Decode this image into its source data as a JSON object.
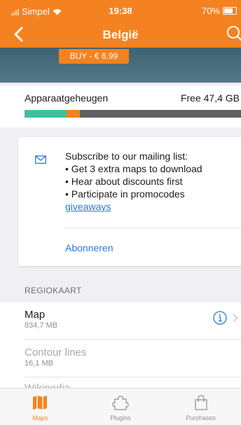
{
  "status_bar": {
    "carrier": "Simpel",
    "time": "19:38",
    "battery": "70%"
  },
  "nav": {
    "title": "België"
  },
  "hero": {
    "buy_label": "BUY - € 6,99"
  },
  "storage": {
    "label": "Apparaatgeheugen",
    "free": "Free 47,4 GB",
    "segments": [
      {
        "name": "other",
        "fraction": 0.195,
        "color": "#3ec1a0"
      },
      {
        "name": "maps",
        "fraction": 0.06,
        "color": "#f58220"
      },
      {
        "name": "rest",
        "fraction": 0.745,
        "color": "#606060"
      }
    ]
  },
  "mailing": {
    "line1": "Subscribe to our mailing list:",
    "line2": "• Get 3 extra maps to download",
    "line3": "• Hear about discounts first",
    "line4": "• Participate in promocodes",
    "link": "giveaways",
    "action": "Abonneren"
  },
  "section": {
    "header": "REGIOKAART"
  },
  "rows": [
    {
      "title": "Map",
      "size": "834,7 MB"
    },
    {
      "title": "Contour lines",
      "size": "16,1 MB"
    },
    {
      "title": "Wikipedia"
    }
  ],
  "tabs": [
    {
      "label": "Maps",
      "icon": "map-icon"
    },
    {
      "label": "Plugins",
      "icon": "puzzle-icon"
    },
    {
      "label": "Purchases",
      "icon": "shopping-bag-icon"
    }
  ],
  "colors": {
    "accent": "#f58220",
    "link": "#2a7bd6",
    "storage_other": "#3ec1a0"
  }
}
